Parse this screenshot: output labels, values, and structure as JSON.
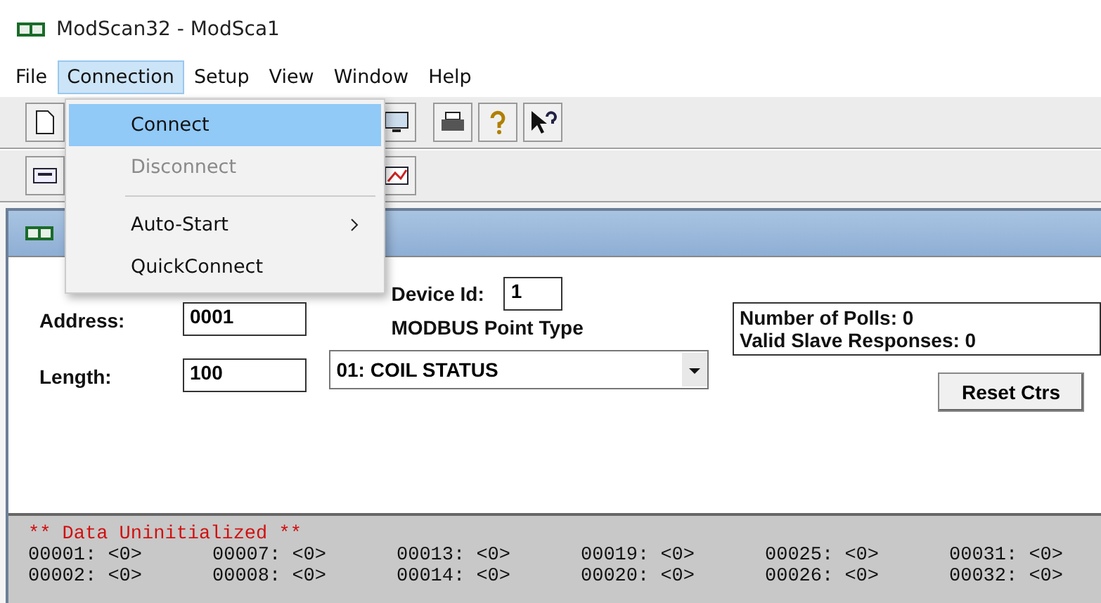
{
  "window": {
    "title": "ModScan32 - ModSca1"
  },
  "menu_bar": [
    {
      "label": "File",
      "selected": false
    },
    {
      "label": "Connection",
      "selected": true
    },
    {
      "label": "Setup",
      "selected": false
    },
    {
      "label": "View",
      "selected": false
    },
    {
      "label": "Window",
      "selected": false
    },
    {
      "label": "Help",
      "selected": false
    }
  ],
  "dropdown": [
    {
      "kind": "item",
      "label": "Connect",
      "selected": true,
      "disabled": false,
      "submenu": false
    },
    {
      "kind": "item",
      "label": "Disconnect",
      "selected": false,
      "disabled": true,
      "submenu": false
    },
    {
      "kind": "separator"
    },
    {
      "kind": "item",
      "label": "Auto-Start",
      "selected": false,
      "disabled": false,
      "submenu": true
    },
    {
      "kind": "item",
      "label": "QuickConnect",
      "selected": false,
      "disabled": false,
      "submenu": false
    }
  ],
  "form": {
    "address_label": "Address:",
    "address": "0001",
    "length_label": "Length:",
    "length": "100",
    "device_id_label": "Device Id:",
    "device_id": "1",
    "point_type_label": "MODBUS Point Type",
    "point_type": "01: COIL STATUS",
    "polls": "Number of Polls: 0",
    "responses": "Valid Slave Responses: 0",
    "reset_button": "Reset Ctrs"
  },
  "data": {
    "status": "** Data Uninitialized **",
    "rows": [
      [
        "00001: <0>",
        "00007: <0>",
        "00013: <0>",
        "00019: <0>",
        "00025: <0>",
        "00031: <0>"
      ],
      [
        "00002: <0>",
        "00008: <0>",
        "00014: <0>",
        "00020: <0>",
        "00026: <0>",
        "00032: <0>"
      ]
    ]
  }
}
